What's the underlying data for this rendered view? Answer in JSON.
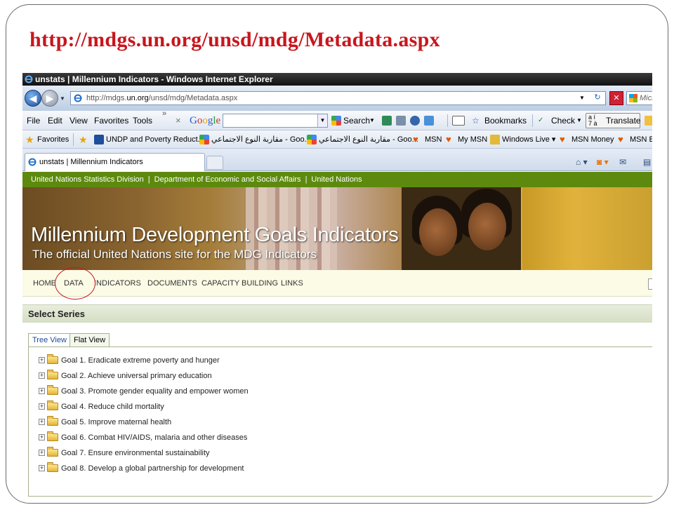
{
  "slide": {
    "url_heading": "http://mdgs.un.org/unsd/mdg/Metadata.aspx"
  },
  "browser": {
    "window_title": "unstats | Millennium Indicators - Windows Internet Explorer",
    "address_prefix": "http://mdgs.",
    "address_domain": "un.org",
    "address_path": "/unsd/mdg/Metadata.aspx",
    "live_search_text": "Microso",
    "menu": [
      "File",
      "Edit",
      "View",
      "Favorites",
      "Tools"
    ],
    "google_toolbar": {
      "search_label": "Search",
      "bookmarks_label": "Bookmarks",
      "check_label": "Check",
      "translate_label": "Translate"
    },
    "favorites_bar": {
      "favorites_label": "Favorites",
      "items": [
        "UNDP and Poverty Reduct...",
        "مقاربة النوع الاجتماعي - Goo...",
        "مقاربة النوع الاجتماعي - Goo...",
        "MSN",
        "My MSN",
        "Windows Live",
        "MSN Money",
        "MSN Er"
      ]
    },
    "tab_title": "unstats | Millennium Indicators"
  },
  "site": {
    "top_links": [
      "United Nations Statistics Division",
      "Department of Economic and Social Affairs",
      "United Nations"
    ],
    "banner_title": "Millennium Development Goals Indicators",
    "banner_subtitle": "The official United Nations site for the MDG Indicators",
    "nav": [
      "HOME",
      "DATA",
      "INDICATORS",
      "DOCUMENTS",
      "CAPACITY BUILDING",
      "LINKS"
    ],
    "section_title": "Select Series",
    "view_tabs": [
      "Tree View",
      "Flat View"
    ],
    "goals": [
      "Goal 1. Eradicate extreme poverty and hunger",
      "Goal 2. Achieve universal primary education",
      "Goal 3. Promote gender equality and empower women",
      "Goal 4. Reduce child mortality",
      "Goal 5. Improve maternal health",
      "Goal 6. Combat HIV/AIDS, malaria and other diseases",
      "Goal 7. Ensure environmental sustainability",
      "Goal 8. Develop a global partnership for development"
    ]
  },
  "colors": {
    "heading_red": "#c8161d",
    "un_green": "#5d8a0e",
    "nav_bg": "#fbfbe6"
  }
}
